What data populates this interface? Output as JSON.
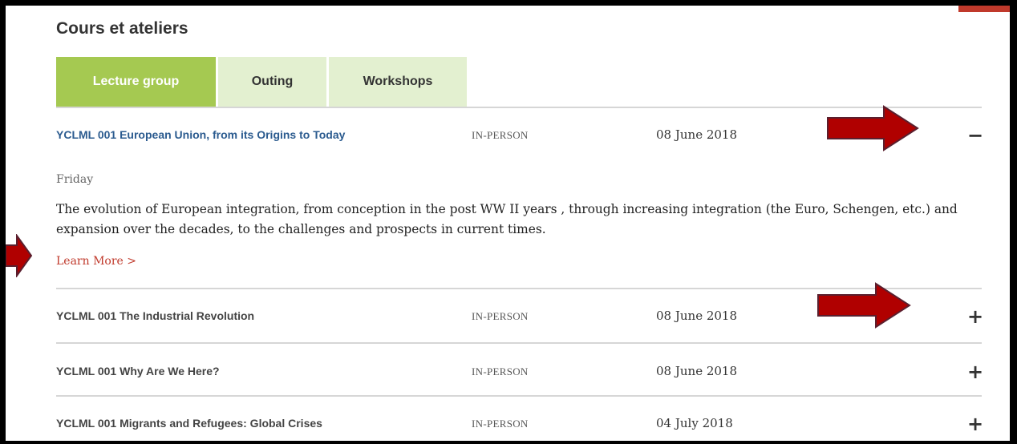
{
  "section": {
    "title": "Cours et ateliers"
  },
  "tabs": [
    {
      "label": "Lecture group",
      "active": true
    },
    {
      "label": "Outing",
      "active": false
    },
    {
      "label": "Workshops",
      "active": false
    }
  ],
  "courses": [
    {
      "title": "YCLML 001 European Union, from its Origins to Today",
      "type": "IN-PERSON",
      "date": "08 June 2018",
      "toggle": "−",
      "expanded": true,
      "day": "Friday",
      "description": "The evolution of European integration, from conception in the post WW II years , through increasing integration (the Euro, Schengen, etc.) and expansion over the decades, to the challenges and prospects in current times.",
      "link_label": "Learn More >"
    },
    {
      "title": "YCLML 001 The Industrial Revolution",
      "type": "IN-PERSON",
      "date": "08 June 2018",
      "toggle": "+",
      "expanded": false
    },
    {
      "title": "YCLML 001 Why Are We Here?",
      "type": "IN-PERSON",
      "date": "08 June 2018",
      "toggle": "+",
      "expanded": false
    },
    {
      "title": "YCLML 001 Migrants and Refugees: Global Crises",
      "type": "IN-PERSON",
      "date": "04 July 2018",
      "toggle": "+",
      "expanded": false
    }
  ],
  "colors": {
    "tab_active": "#a5c951",
    "tab_inactive": "#e3f0d0",
    "link_open": "#2b5b8f",
    "learn_more": "#c0392b",
    "annotation_arrow": "#b00000"
  },
  "annotations": [
    {
      "icon": "red-arrow-right-icon"
    },
    {
      "icon": "red-arrow-right-icon"
    },
    {
      "icon": "red-arrow-right-icon"
    }
  ]
}
